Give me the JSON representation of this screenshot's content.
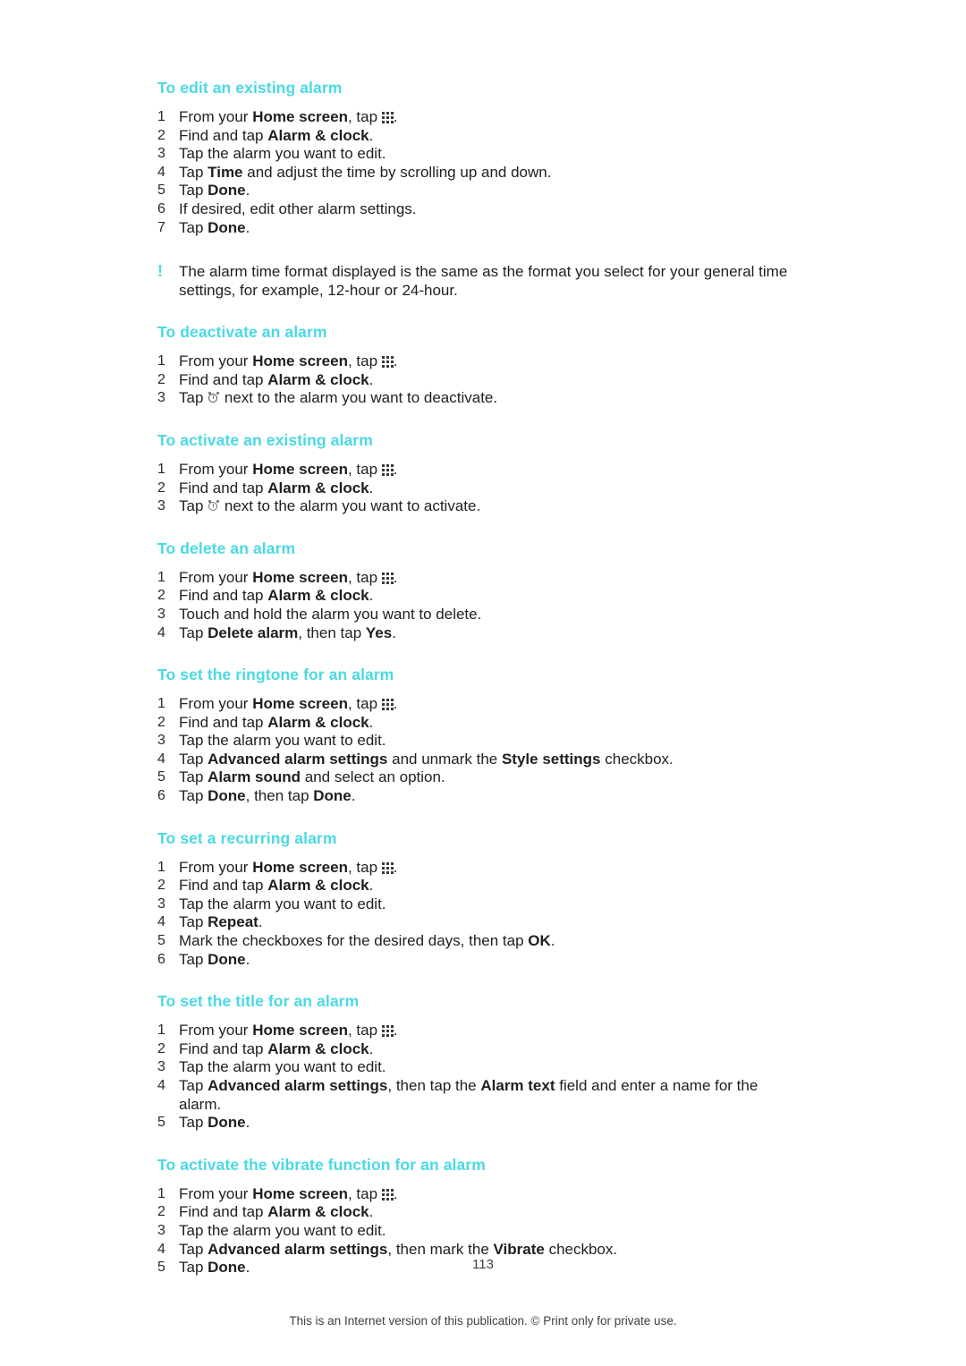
{
  "document": {
    "page_number": "113",
    "footer": "This is an Internet version of this publication. © Print only for private use.",
    "accent_color": "#4ad9e4",
    "text_color": "#1f1f1f"
  },
  "sections": [
    {
      "title": "To edit an existing alarm",
      "steps": [
        {
          "num": "1",
          "parts": [
            {
              "t": "From your "
            },
            {
              "t": "Home screen",
              "b": true
            },
            {
              "t": ", tap "
            },
            {
              "icon": "app-grid-icon"
            },
            {
              "t": "."
            }
          ]
        },
        {
          "num": "2",
          "parts": [
            {
              "t": "Find and tap "
            },
            {
              "t": "Alarm & clock",
              "b": true
            },
            {
              "t": "."
            }
          ]
        },
        {
          "num": "3",
          "parts": [
            {
              "t": "Tap the alarm you want to edit."
            }
          ]
        },
        {
          "num": "4",
          "parts": [
            {
              "t": "Tap "
            },
            {
              "t": "Time",
              "b": true
            },
            {
              "t": " and adjust the time by scrolling up and down."
            }
          ]
        },
        {
          "num": "5",
          "parts": [
            {
              "t": "Tap "
            },
            {
              "t": "Done",
              "b": true
            },
            {
              "t": "."
            }
          ]
        },
        {
          "num": "6",
          "parts": [
            {
              "t": "If desired, edit other alarm settings."
            }
          ]
        },
        {
          "num": "7",
          "parts": [
            {
              "t": "Tap "
            },
            {
              "t": "Done",
              "b": true
            },
            {
              "t": "."
            }
          ]
        }
      ],
      "note": {
        "icon": "exclamation-icon",
        "text": "The alarm time format displayed is the same as the format you select for your general time settings, for example, 12-hour or 24-hour."
      }
    },
    {
      "title": "To deactivate an alarm",
      "steps": [
        {
          "num": "1",
          "parts": [
            {
              "t": "From your "
            },
            {
              "t": "Home screen",
              "b": true
            },
            {
              "t": ", tap "
            },
            {
              "icon": "app-grid-icon"
            },
            {
              "t": "."
            }
          ]
        },
        {
          "num": "2",
          "parts": [
            {
              "t": "Find and tap "
            },
            {
              "t": "Alarm & clock",
              "b": true
            },
            {
              "t": "."
            }
          ]
        },
        {
          "num": "3",
          "parts": [
            {
              "t": "Tap "
            },
            {
              "icon": "alarm-clock-icon-on"
            },
            {
              "t": " next to the alarm you want to deactivate."
            }
          ]
        }
      ]
    },
    {
      "title": "To activate an existing alarm",
      "steps": [
        {
          "num": "1",
          "parts": [
            {
              "t": "From your "
            },
            {
              "t": "Home screen",
              "b": true
            },
            {
              "t": ", tap "
            },
            {
              "icon": "app-grid-icon"
            },
            {
              "t": "."
            }
          ]
        },
        {
          "num": "2",
          "parts": [
            {
              "t": "Find and tap "
            },
            {
              "t": "Alarm & clock",
              "b": true
            },
            {
              "t": "."
            }
          ]
        },
        {
          "num": "3",
          "parts": [
            {
              "t": "Tap "
            },
            {
              "icon": "alarm-clock-icon-off"
            },
            {
              "t": " next to the alarm you want to activate."
            }
          ]
        }
      ]
    },
    {
      "title": "To delete an alarm",
      "steps": [
        {
          "num": "1",
          "parts": [
            {
              "t": "From your "
            },
            {
              "t": "Home screen",
              "b": true
            },
            {
              "t": ", tap "
            },
            {
              "icon": "app-grid-icon"
            },
            {
              "t": "."
            }
          ]
        },
        {
          "num": "2",
          "parts": [
            {
              "t": "Find and tap "
            },
            {
              "t": "Alarm & clock",
              "b": true
            },
            {
              "t": "."
            }
          ]
        },
        {
          "num": "3",
          "parts": [
            {
              "t": "Touch and hold the alarm you want to delete."
            }
          ]
        },
        {
          "num": "4",
          "parts": [
            {
              "t": "Tap "
            },
            {
              "t": "Delete alarm",
              "b": true
            },
            {
              "t": ", then tap "
            },
            {
              "t": "Yes",
              "b": true
            },
            {
              "t": "."
            }
          ]
        }
      ]
    },
    {
      "title": "To set the ringtone for an alarm",
      "steps": [
        {
          "num": "1",
          "parts": [
            {
              "t": "From your "
            },
            {
              "t": "Home screen",
              "b": true
            },
            {
              "t": ", tap "
            },
            {
              "icon": "app-grid-icon"
            },
            {
              "t": "."
            }
          ]
        },
        {
          "num": "2",
          "parts": [
            {
              "t": "Find and tap "
            },
            {
              "t": "Alarm & clock",
              "b": true
            },
            {
              "t": "."
            }
          ]
        },
        {
          "num": "3",
          "parts": [
            {
              "t": "Tap the alarm you want to edit."
            }
          ]
        },
        {
          "num": "4",
          "parts": [
            {
              "t": "Tap "
            },
            {
              "t": "Advanced alarm settings",
              "b": true
            },
            {
              "t": " and unmark the "
            },
            {
              "t": "Style settings",
              "b": true
            },
            {
              "t": " checkbox."
            }
          ]
        },
        {
          "num": "5",
          "parts": [
            {
              "t": "Tap "
            },
            {
              "t": "Alarm sound",
              "b": true
            },
            {
              "t": " and select an option."
            }
          ]
        },
        {
          "num": "6",
          "parts": [
            {
              "t": "Tap "
            },
            {
              "t": "Done",
              "b": true
            },
            {
              "t": ", then tap "
            },
            {
              "t": "Done",
              "b": true
            },
            {
              "t": "."
            }
          ]
        }
      ]
    },
    {
      "title": "To set a recurring alarm",
      "steps": [
        {
          "num": "1",
          "parts": [
            {
              "t": "From your "
            },
            {
              "t": "Home screen",
              "b": true
            },
            {
              "t": ", tap "
            },
            {
              "icon": "app-grid-icon"
            },
            {
              "t": "."
            }
          ]
        },
        {
          "num": "2",
          "parts": [
            {
              "t": "Find and tap "
            },
            {
              "t": "Alarm & clock",
              "b": true
            },
            {
              "t": "."
            }
          ]
        },
        {
          "num": "3",
          "parts": [
            {
              "t": "Tap the alarm you want to edit."
            }
          ]
        },
        {
          "num": "4",
          "parts": [
            {
              "t": "Tap "
            },
            {
              "t": "Repeat",
              "b": true
            },
            {
              "t": "."
            }
          ]
        },
        {
          "num": "5",
          "parts": [
            {
              "t": "Mark the checkboxes for the desired days, then tap "
            },
            {
              "t": "OK",
              "b": true
            },
            {
              "t": "."
            }
          ]
        },
        {
          "num": "6",
          "parts": [
            {
              "t": "Tap "
            },
            {
              "t": "Done",
              "b": true
            },
            {
              "t": "."
            }
          ]
        }
      ]
    },
    {
      "title": "To set the title for an alarm",
      "steps": [
        {
          "num": "1",
          "parts": [
            {
              "t": "From your "
            },
            {
              "t": "Home screen",
              "b": true
            },
            {
              "t": ", tap "
            },
            {
              "icon": "app-grid-icon"
            },
            {
              "t": "."
            }
          ]
        },
        {
          "num": "2",
          "parts": [
            {
              "t": "Find and tap "
            },
            {
              "t": "Alarm & clock",
              "b": true
            },
            {
              "t": "."
            }
          ]
        },
        {
          "num": "3",
          "parts": [
            {
              "t": "Tap the alarm you want to edit."
            }
          ]
        },
        {
          "num": "4",
          "parts": [
            {
              "t": "Tap "
            },
            {
              "t": "Advanced alarm settings",
              "b": true
            },
            {
              "t": ", then tap the "
            },
            {
              "t": "Alarm text",
              "b": true
            },
            {
              "t": " field and enter a name for the alarm."
            }
          ]
        },
        {
          "num": "5",
          "parts": [
            {
              "t": "Tap "
            },
            {
              "t": "Done",
              "b": true
            },
            {
              "t": "."
            }
          ]
        }
      ]
    },
    {
      "title": "To activate the vibrate function for an alarm",
      "steps": [
        {
          "num": "1",
          "parts": [
            {
              "t": "From your "
            },
            {
              "t": "Home screen",
              "b": true
            },
            {
              "t": ", tap "
            },
            {
              "icon": "app-grid-icon"
            },
            {
              "t": "."
            }
          ]
        },
        {
          "num": "2",
          "parts": [
            {
              "t": "Find and tap "
            },
            {
              "t": "Alarm & clock",
              "b": true
            },
            {
              "t": "."
            }
          ]
        },
        {
          "num": "3",
          "parts": [
            {
              "t": "Tap the alarm you want to edit."
            }
          ]
        },
        {
          "num": "4",
          "parts": [
            {
              "t": "Tap "
            },
            {
              "t": "Advanced alarm settings",
              "b": true
            },
            {
              "t": ", then mark the "
            },
            {
              "t": "Vibrate",
              "b": true
            },
            {
              "t": " checkbox."
            }
          ]
        },
        {
          "num": "5",
          "parts": [
            {
              "t": "Tap "
            },
            {
              "t": "Done",
              "b": true
            },
            {
              "t": "."
            }
          ]
        }
      ]
    }
  ]
}
